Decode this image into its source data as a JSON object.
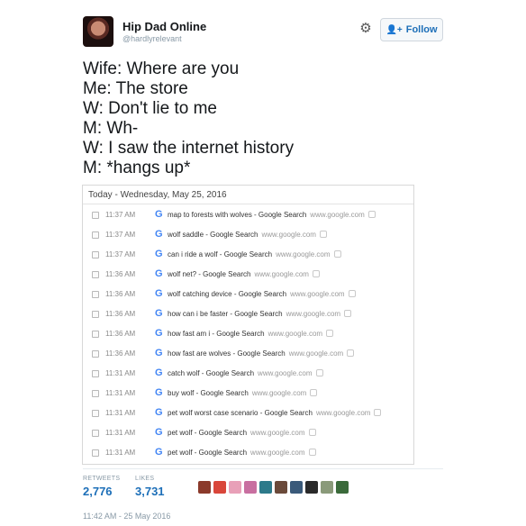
{
  "author": {
    "name": "Hip Dad Online",
    "handle": "@hardlyrelevant"
  },
  "actions": {
    "follow_label": "Follow",
    "settings_icon": "gear-icon",
    "follow_icon": "add-user-icon"
  },
  "tweet": {
    "lines": [
      "Wife: Where are you",
      "Me: The store",
      "W: Don't lie to me",
      "M: Wh-",
      "W: I saw the internet history",
      "M: *hangs up*"
    ]
  },
  "history": {
    "date_header": "Today - Wednesday, May 25, 2016",
    "entries": [
      {
        "time": "11:37 AM",
        "query": "map to forests with wolves - Google Search",
        "domain": "www.google.com"
      },
      {
        "time": "11:37 AM",
        "query": "wolf saddle - Google Search",
        "domain": "www.google.com"
      },
      {
        "time": "11:37 AM",
        "query": "can i ride a wolf - Google Search",
        "domain": "www.google.com"
      },
      {
        "time": "11:36 AM",
        "query": "wolf net? - Google Search",
        "domain": "www.google.com"
      },
      {
        "time": "11:36 AM",
        "query": "wolf catching device - Google Search",
        "domain": "www.google.com"
      },
      {
        "time": "11:36 AM",
        "query": "how can i be faster - Google Search",
        "domain": "www.google.com"
      },
      {
        "time": "11:36 AM",
        "query": "how fast am i - Google Search",
        "domain": "www.google.com"
      },
      {
        "time": "11:36 AM",
        "query": "how fast are wolves - Google Search",
        "domain": "www.google.com"
      },
      {
        "time": "11:31 AM",
        "query": "catch wolf - Google Search",
        "domain": "www.google.com"
      },
      {
        "time": "11:31 AM",
        "query": "buy wolf - Google Search",
        "domain": "www.google.com"
      },
      {
        "time": "11:31 AM",
        "query": "pet wolf worst case scenario - Google Search",
        "domain": "www.google.com"
      },
      {
        "time": "11:31 AM",
        "query": "pet wolf - Google Search",
        "domain": "www.google.com"
      },
      {
        "time": "11:31 AM",
        "query": "pet wolf - Google Search",
        "domain": "www.google.com"
      }
    ]
  },
  "stats": {
    "retweets_label": "RETWEETS",
    "retweets_value": "2,776",
    "likes_label": "LIKES",
    "likes_value": "3,731",
    "liker_colors": [
      "#8b3a2b",
      "#d9463a",
      "#e8a0b8",
      "#c86fa0",
      "#2d7a8a",
      "#6b4a3a",
      "#3a5a7a",
      "#2a2a2a",
      "#8a9a7a",
      "#3a6a3a"
    ]
  },
  "timestamp": "11:42 AM - 25 May 2016"
}
